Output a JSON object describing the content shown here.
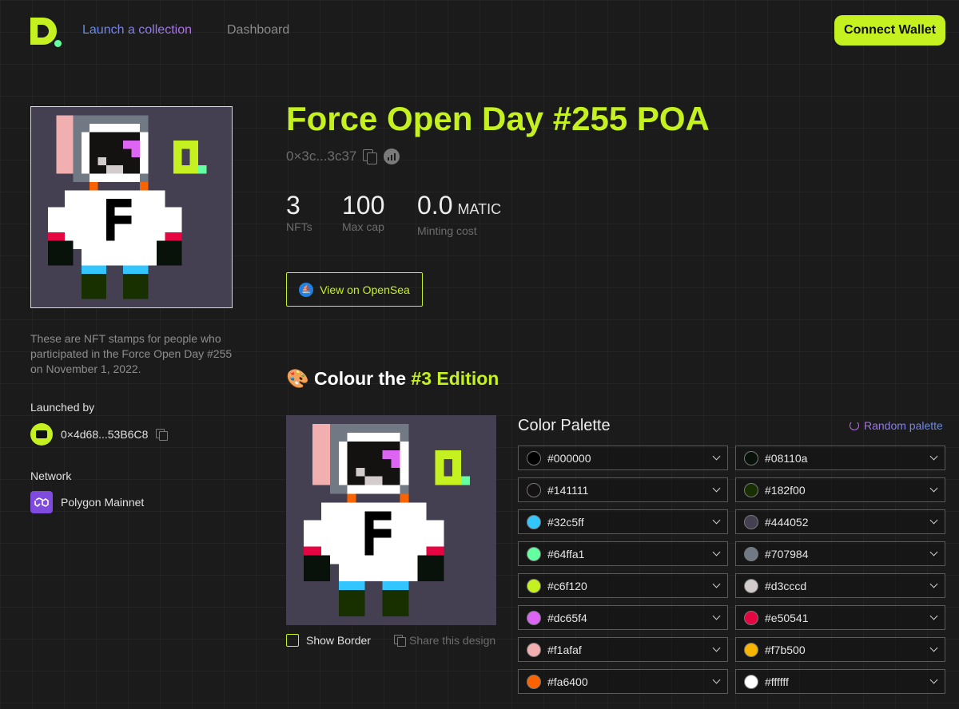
{
  "header": {
    "nav_launch": "Launch a collection",
    "nav_dashboard": "Dashboard",
    "connect_wallet": "Connect Wallet"
  },
  "collection": {
    "title": "Force Open Day #255 POA",
    "address": "0×3c...3c37",
    "description": "These are NFT stamps for people who participated in the Force Open Day #255 on November 1, 2022.",
    "launched_by_label": "Launched by",
    "launcher_address": "0×4d68...53B6C8",
    "network_label": "Network",
    "network_name": "Polygon Mainnet",
    "stats": {
      "nfts_value": "3",
      "nfts_label": "NFTs",
      "max_cap_value": "100",
      "max_cap_label": "Max cap",
      "minting_cost_value": "0.0",
      "minting_cost_unit": "MATIC",
      "minting_cost_label": "Minting cost"
    },
    "opensea_button": "View on OpenSea"
  },
  "edition": {
    "emoji": "🎨",
    "title_prefix": "Colour the ",
    "title_highlight": "#3 Edition",
    "show_border_label": "Show Border",
    "share_label": "Share this design"
  },
  "palette": {
    "title": "Color Palette",
    "random_label": "Random palette",
    "left": [
      "#000000",
      "#141111",
      "#32c5ff",
      "#64ffa1",
      "#c6f120",
      "#dc65f4",
      "#f1afaf",
      "#fa6400"
    ],
    "right": [
      "#08110a",
      "#182f00",
      "#444052",
      "#707984",
      "#d3cccd",
      "#e50541",
      "#f7b500",
      "#ffffff"
    ]
  },
  "colors": {
    "accent": "#c6f120",
    "background": "#1b1b1b"
  }
}
